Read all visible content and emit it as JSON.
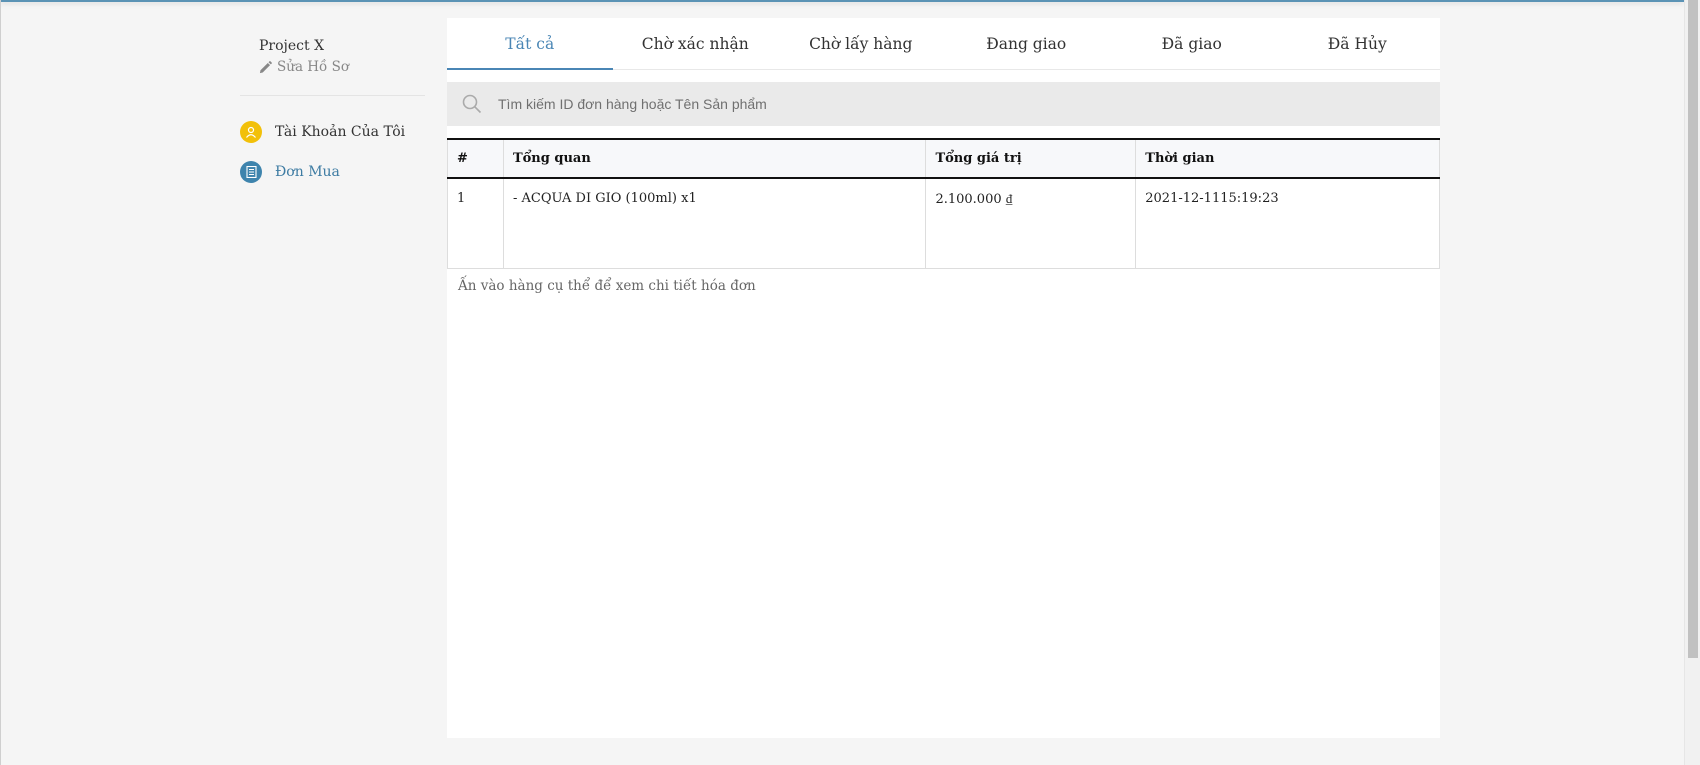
{
  "sidebar": {
    "profile_name": "Project X",
    "edit_label": "Sửa Hồ Sơ",
    "items": [
      {
        "label": "Tài Khoản Của Tôi",
        "icon": "user-icon",
        "color": "#f2c009"
      },
      {
        "label": "Đơn Mua",
        "icon": "document-icon",
        "color": "#3e84ad",
        "active": true
      }
    ]
  },
  "tabs": [
    {
      "label": "Tất cả",
      "active": true
    },
    {
      "label": "Chờ xác nhận"
    },
    {
      "label": "Chờ lấy hàng"
    },
    {
      "label": "Đang giao"
    },
    {
      "label": "Đã giao"
    },
    {
      "label": "Đã Hủy"
    }
  ],
  "search": {
    "placeholder": "Tìm kiếm ID đơn hàng hoặc Tên Sản phẩm",
    "value": ""
  },
  "table": {
    "columns": [
      "#",
      "Tổng quan",
      "Tổng giá trị",
      "Thời gian"
    ],
    "rows": [
      {
        "id": "1",
        "overview": "- ACQUA DI GIO (100ml) x1",
        "total": "2.100.000 ₫",
        "time": "2021-12-1115:19:23"
      }
    ]
  },
  "hint": "Ấn vào hàng cụ thể để xem chi tiết hóa đơn",
  "colors": {
    "accent": "#4a86b5",
    "yellow_icon": "#f2c009",
    "blue_icon": "#3e84ad"
  }
}
